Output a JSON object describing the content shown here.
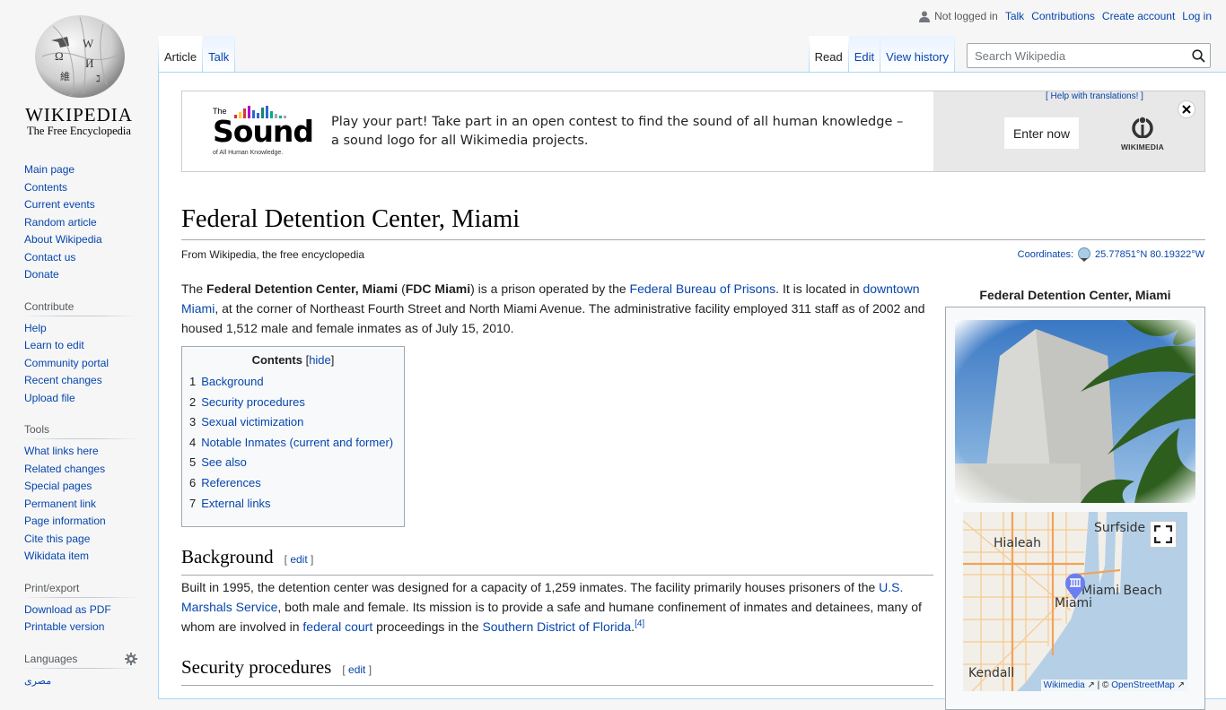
{
  "logo": {
    "wordmark": "Wikipedia",
    "tagline": "The Free Encyclopedia"
  },
  "personal": {
    "status": "Not logged in",
    "links": [
      "Talk",
      "Contributions",
      "Create account",
      "Log in"
    ]
  },
  "tabs": {
    "left": [
      {
        "label": "Article",
        "selected": true
      },
      {
        "label": "Talk",
        "selected": false
      }
    ],
    "right": [
      {
        "label": "Read",
        "selected": true
      },
      {
        "label": "Edit",
        "selected": false
      },
      {
        "label": "View history",
        "selected": false
      }
    ]
  },
  "search": {
    "placeholder": "Search Wikipedia",
    "value": ""
  },
  "sidebar": {
    "navigation": [
      "Main page",
      "Contents",
      "Current events",
      "Random article",
      "About Wikipedia",
      "Contact us",
      "Donate"
    ],
    "contribute": {
      "heading": "Contribute",
      "items": [
        "Help",
        "Learn to edit",
        "Community portal",
        "Recent changes",
        "Upload file"
      ]
    },
    "tools": {
      "heading": "Tools",
      "items": [
        "What links here",
        "Related changes",
        "Special pages",
        "Permanent link",
        "Page information",
        "Cite this page",
        "Wikidata item"
      ]
    },
    "print": {
      "heading": "Print/export",
      "items": [
        "Download as PDF",
        "Printable version"
      ]
    },
    "languages": {
      "heading": "Languages",
      "items": [
        "مصرى"
      ]
    }
  },
  "banner": {
    "logo_the": "The",
    "logo_word": "Sound",
    "logo_sub": "of All Human Knowledge.",
    "text": "Play your part! Take part in an open contest to find the sound of all human knowledge – a sound logo for all Wikimedia projects.",
    "help_link": "[ Help with translations! ]",
    "cta": "Enter now",
    "wikimedia_label": "WIKIMEDIA",
    "bar_colors": [
      "#d33",
      "#fc3",
      "#d33",
      "#a0c",
      "#36c",
      "#36c",
      "#14866d",
      "#36c",
      "#00af89",
      "#a2a9b1",
      "#00af89",
      "#a2a9b1"
    ]
  },
  "article": {
    "title": "Federal Detention Center, Miami",
    "from": "From Wikipedia, the free encyclopedia",
    "coordinates_label": "Coordinates:",
    "coordinates_value": "25.77851°N 80.19322°W",
    "intro": {
      "t1": "The ",
      "b1": "Federal Detention Center, Miami",
      "t2": " (",
      "b2": "FDC Miami",
      "t3": ") is a prison operated by the ",
      "l1": "Federal Bureau of Prisons",
      "t4": ". It is located in ",
      "l2": "downtown Miami",
      "t5": ", at the corner of Northeast Fourth Street and North Miami Avenue. The administrative facility employed 311 staff as of 2002 and housed 1,512 male and female inmates as of July 15, 2010."
    },
    "toc": {
      "title": "Contents",
      "hide": "hide",
      "items": [
        {
          "num": "1",
          "label": "Background"
        },
        {
          "num": "2",
          "label": "Security procedures"
        },
        {
          "num": "3",
          "label": "Sexual victimization"
        },
        {
          "num": "4",
          "label": "Notable Inmates (current and former)"
        },
        {
          "num": "5",
          "label": "See also"
        },
        {
          "num": "6",
          "label": "References"
        },
        {
          "num": "7",
          "label": "External links"
        }
      ]
    },
    "sections": {
      "background": {
        "heading": "Background",
        "edit": "edit",
        "t1": "Built in 1995, the detention center was designed for a capacity of 1,259 inmates. The facility primarily houses prisoners of the ",
        "l1": "U.S. Marshals Service",
        "t2": ", both male and female. Its mission is to provide a safe and humane confinement of inmates and detainees, many of whom are involved in ",
        "l2": "federal court",
        "t3": " proceedings in the ",
        "l3": "Southern District of Florida",
        "t4": ".",
        "ref": "[4]"
      },
      "security": {
        "heading": "Security procedures",
        "edit": "edit"
      }
    },
    "infobox": {
      "title": "Federal Detention Center, Miami",
      "map_labels": [
        "Hialeah",
        "Surfside",
        "Miami Beach",
        "Miami",
        "Kendall"
      ],
      "attribution_wikimedia": "Wikimedia",
      "attribution_osm": "OpenStreetMap"
    }
  }
}
